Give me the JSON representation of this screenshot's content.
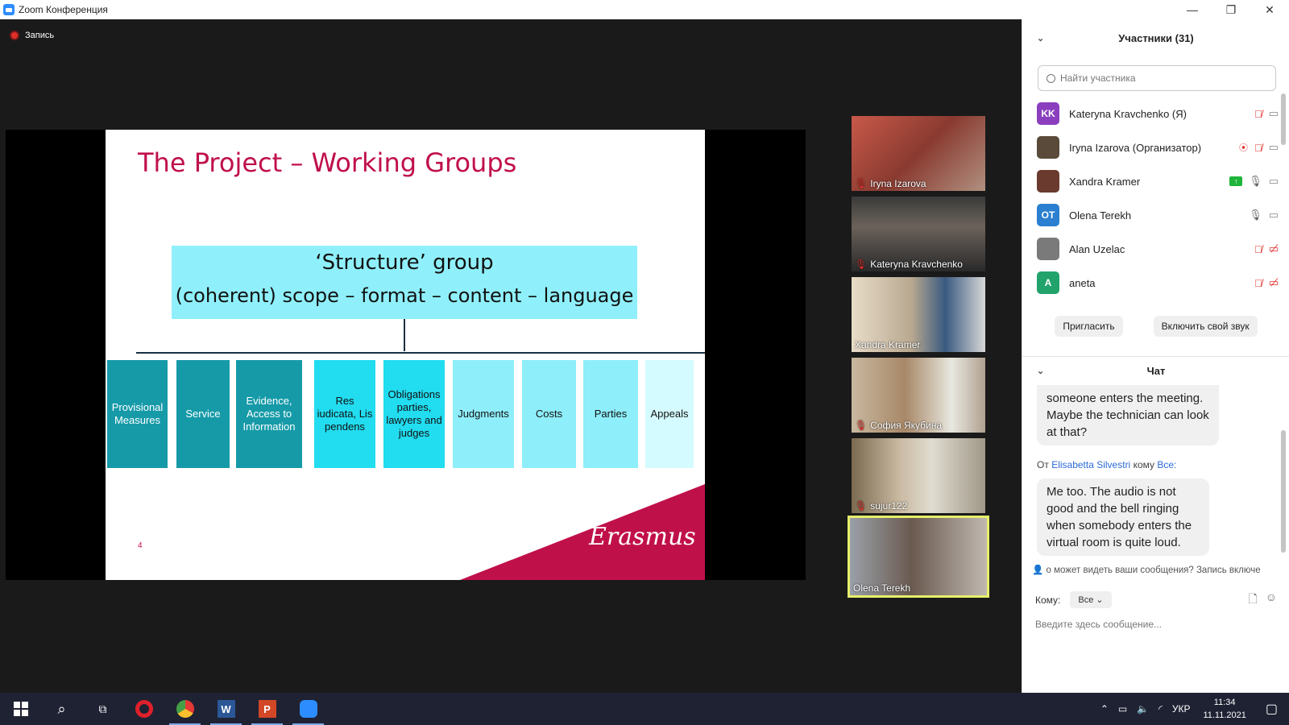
{
  "window": {
    "title": "Zoom Конференция",
    "controls": {
      "minimize": "—",
      "restore": "❐",
      "close": "✕"
    }
  },
  "stage": {
    "recording_label": "Запись",
    "slide": {
      "title": "The Project – Working Groups",
      "structure_line1": "‘Structure’ group",
      "structure_line2": "(coherent) scope – format – content – language",
      "page_number": "4",
      "logo_text": "Erasmus",
      "groups": [
        {
          "label": "Provisional Measures",
          "color": "#169aa8"
        },
        {
          "label": "Service",
          "color": "#169aa8"
        },
        {
          "label": "Evidence, Access to Information",
          "color": "#169aa8"
        },
        {
          "label": "Res iudicata, Lis pendens",
          "color": "#22dcf0"
        },
        {
          "label": "Obligations parties, lawyers and judges",
          "color": "#22dcf0"
        },
        {
          "label": "Judgments",
          "color": "#8eeefa"
        },
        {
          "label": "Costs",
          "color": "#8eeefa"
        },
        {
          "label": "Parties",
          "color": "#8eeefa"
        },
        {
          "label": "Appeals",
          "color": "#d4fbff"
        }
      ]
    },
    "videos": [
      {
        "name": "Iryna Izarova",
        "muted": true
      },
      {
        "name": "Kateryna Kravchenko",
        "muted": true
      },
      {
        "name": "Xandra Kramer",
        "muted": false
      },
      {
        "name": "София Якубина",
        "muted": true
      },
      {
        "name": "sujur122",
        "muted": true
      },
      {
        "name": "Olena Terekh",
        "muted": false,
        "active": true
      }
    ]
  },
  "participants": {
    "header": "Участники (31)",
    "search_placeholder": "Найти участника",
    "list": [
      {
        "initials": "KK",
        "avatar_color": "#8b3fbf",
        "name": "Kateryna Kravchenko (Я)",
        "mic": "muted",
        "cam": "on"
      },
      {
        "initials": "",
        "avatar_color": "#5a4a3a",
        "name": "Iryna Izarova (Организатор)",
        "mic": "muted",
        "cam": "on",
        "recording": true
      },
      {
        "initials": "",
        "avatar_color": "#6b3a2e",
        "name": "Xandra Kramer",
        "mic": "on",
        "cam": "on",
        "sharing": true
      },
      {
        "initials": "OT",
        "avatar_color": "#2a7fd0",
        "name": "Olena Terekh",
        "mic": "on",
        "cam": "on"
      },
      {
        "initials": "",
        "avatar_color": "#7a7a7a",
        "name": "Alan Uzelac",
        "mic": "muted",
        "cam": "off"
      },
      {
        "initials": "A",
        "avatar_color": "#22a36b",
        "name": "aneta",
        "mic": "muted",
        "cam": "off"
      }
    ],
    "invite_button": "Пригласить",
    "unmute_button": "Включить свой звук"
  },
  "chat": {
    "header": "Чат",
    "partial_message": "someone enters the meeting. Maybe the technician can look at that?",
    "from_prefix": "От",
    "from_name": "Elisabetta Silvestri",
    "to_prefix": "кому",
    "to_name": "Все:",
    "message": "Me too. The audio is not good and the bell ringing when somebody enters the virtual room is quite loud.",
    "notice": "о может видеть ваши сообщения? Запись включе",
    "to_label": "Кому:",
    "to_value": "Все",
    "input_placeholder": "Введите здесь сообщение..."
  },
  "taskbar": {
    "lang": "УКР",
    "time": "11:34",
    "date": "11.11.2021"
  }
}
